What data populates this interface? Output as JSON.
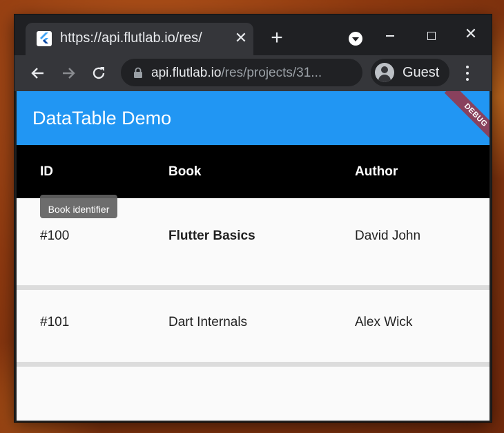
{
  "browser": {
    "tab_title": "https://api.flutlab.io/res/",
    "tab_close": "✕",
    "new_tab": "+",
    "window_close": "✕",
    "url_host": "api.flutlab.io",
    "url_path": "/res/projects/31...",
    "profile_label": "Guest"
  },
  "app": {
    "title": "DataTable Demo",
    "debug_banner": "DEBUG",
    "accent_color": "#2196f3"
  },
  "table": {
    "columns": [
      "ID",
      "Book",
      "Author"
    ],
    "tooltip": "Book identifier",
    "rows": [
      [
        "#100",
        "Flutter Basics",
        "David John"
      ],
      [
        "#101",
        "Dart Internals",
        "Alex Wick"
      ]
    ]
  }
}
